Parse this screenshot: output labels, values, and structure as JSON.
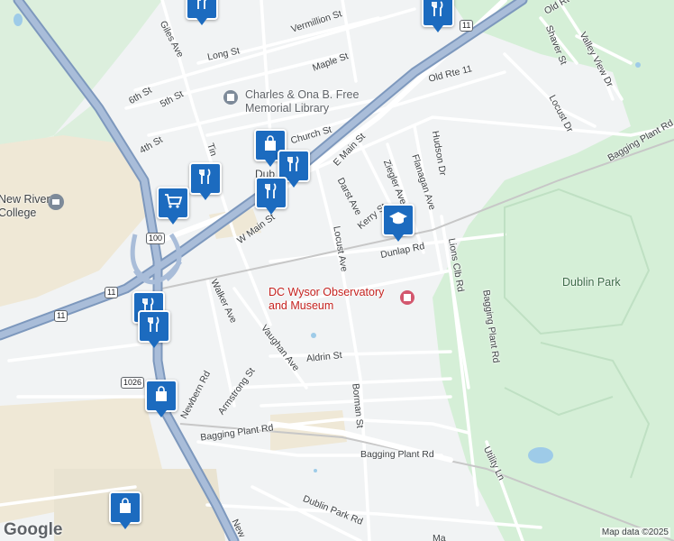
{
  "map": {
    "streets": [
      {
        "label": "Giles Ave"
      },
      {
        "label": "Vermillion St"
      },
      {
        "label": "Long St"
      },
      {
        "label": "Maple St"
      },
      {
        "label": "6th St"
      },
      {
        "label": "5th St"
      },
      {
        "label": "4th St"
      },
      {
        "label": "Church St"
      },
      {
        "label": "E Main St"
      },
      {
        "label": "Darst Ave"
      },
      {
        "label": "Kerry St"
      },
      {
        "label": "Ziegler Ave"
      },
      {
        "label": "Flanagan Ave"
      },
      {
        "label": "Hudson Dr"
      },
      {
        "label": "Old Rte 11"
      },
      {
        "label": "Shaver St"
      },
      {
        "label": "Valley View Dr"
      },
      {
        "label": "Locust Dr"
      },
      {
        "label": "Bagging Plant Rd"
      },
      {
        "label": "Dunlap Rd"
      },
      {
        "label": "Lions Clb Rd"
      },
      {
        "label": "Locust Ave"
      },
      {
        "label": "W Main St"
      },
      {
        "label": "Walker Ave"
      },
      {
        "label": "Vaughan Ave"
      },
      {
        "label": "Aldrin St"
      },
      {
        "label": "Armstrong St"
      },
      {
        "label": "Newbern Rd"
      },
      {
        "label": "Borman St"
      },
      {
        "label": "Bagging Plant Rd"
      },
      {
        "label": "Bagging Plant Rd"
      },
      {
        "label": "Bagging Plant Rd"
      },
      {
        "label": "Utility Ln"
      },
      {
        "label": "Dublin Park Rd"
      },
      {
        "label": "Old Rt"
      },
      {
        "label": "Tin"
      },
      {
        "label": "Dub"
      },
      {
        "label": "New"
      },
      {
        "label": "Ma"
      }
    ],
    "places": {
      "library": "Charles & Ona B. Free\nMemorial Library",
      "observatory": "DC Wysor Observatory\nand Museum",
      "park": "Dublin Park",
      "college": "New River\nCollege"
    },
    "route_shields": [
      "11",
      "11",
      "100",
      "11",
      "1026"
    ],
    "markers": [
      {
        "type": "restaurant",
        "icon": "fork-knife-icon"
      },
      {
        "type": "restaurant",
        "icon": "fork-knife-icon"
      },
      {
        "type": "shopping",
        "icon": "shopping-bag-icon"
      },
      {
        "type": "restaurant",
        "icon": "fork-knife-icon"
      },
      {
        "type": "restaurant",
        "icon": "fork-knife-icon"
      },
      {
        "type": "shopping",
        "icon": "shopping-cart-icon"
      },
      {
        "type": "school",
        "icon": "graduation-cap-icon"
      },
      {
        "type": "restaurant",
        "icon": "fork-knife-icon"
      },
      {
        "type": "restaurant",
        "icon": "fork-knife-icon"
      },
      {
        "type": "shopping",
        "icon": "shopping-bag-icon"
      },
      {
        "type": "shopping",
        "icon": "shopping-bag-icon"
      },
      {
        "type": "restaurant",
        "icon": "fork-knife-icon"
      }
    ],
    "attribution": {
      "logo": "Google",
      "copyright": "Map data ©2025"
    },
    "colors": {
      "highway": "#8ea7c9",
      "park": "#d5efd7",
      "developed": "#f0ead9",
      "water": "#9ecbe8",
      "marker": "#1c6bbf"
    }
  }
}
